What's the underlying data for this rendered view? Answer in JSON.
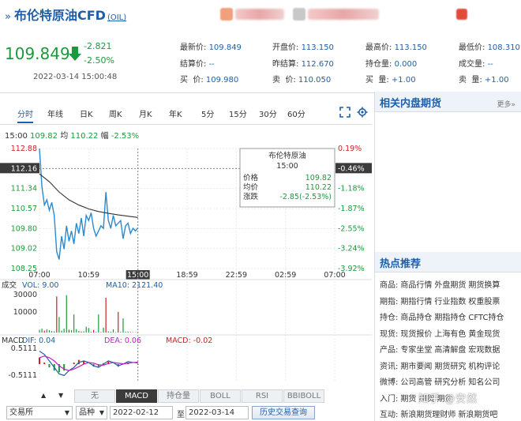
{
  "header": {
    "arrows": "»",
    "title": "布伦特原油CFD",
    "code": "(OIL)",
    "price": "109.849",
    "change_abs": "-2.821",
    "change_pct": "-2.50%",
    "datetime": "2022-03-14 15:00:48",
    "quotes": [
      {
        "label": "最新价: ",
        "value": "109.849",
        "color": "blue"
      },
      {
        "label": "开盘价: ",
        "value": "113.150",
        "color": "blue"
      },
      {
        "label": "最高价: ",
        "value": "113.150",
        "color": "blue"
      },
      {
        "label": "最低价: ",
        "value": "108.310",
        "color": "blue"
      },
      {
        "label": "结算价: ",
        "value": "--",
        "color": "blue"
      },
      {
        "label": "昨结算: ",
        "value": "112.670",
        "color": "blue"
      },
      {
        "label": "持仓量: ",
        "value": "0.000",
        "color": "blue"
      },
      {
        "label": "成交量: ",
        "value": "--",
        "color": "blue"
      },
      {
        "label": "买  价: ",
        "value": "109.980",
        "color": "blue"
      },
      {
        "label": "卖  价: ",
        "value": "110.050",
        "color": "blue"
      },
      {
        "label": "买  量: ",
        "value": "+1.00",
        "color": "blue"
      },
      {
        "label": "卖  量: ",
        "value": "+1.00",
        "color": "blue"
      }
    ]
  },
  "tabs": [
    "分时",
    "年线",
    "日K",
    "周K",
    "月K",
    "年K",
    "5分",
    "15分",
    "30分",
    "60分"
  ],
  "active_tab": "分时",
  "info_line": {
    "time": "15:00",
    "price": "109.82",
    "avg_label": "均",
    "avg": "110.22",
    "amp_label": "幅",
    "amp": "-2.53%"
  },
  "tooltip": {
    "name": "布伦特原油",
    "time": "15:00",
    "rows": [
      {
        "label": "价格",
        "value": "109.82"
      },
      {
        "label": "均价",
        "value": "110.22"
      },
      {
        "label": "涨跌",
        "value": "-2.85(-2.53%)"
      }
    ]
  },
  "volume_panel": {
    "label": "成交",
    "vol_label": "VOL: 9.00",
    "ma_label": "MA10: 2121.40",
    "ticks": [
      "30000",
      "10000"
    ]
  },
  "macd_panel": {
    "label": "MACD",
    "dif": "DIF: 0.04",
    "dea": "DEA: 0.06",
    "macd": "MACD: -0.02",
    "ticks": [
      "0.5111",
      "-0.5111"
    ]
  },
  "indicator_tabs": [
    "无",
    "MACD",
    "持仓量",
    "BOLL",
    "RSI",
    "BBIBOLL"
  ],
  "active_indicator": "MACD",
  "filters": {
    "exchange": "交易所",
    "variety": "品种",
    "date_from": "2022-02-12",
    "to_label": "至",
    "date_to": "2022-03-14",
    "history_button": "历史交易查询"
  },
  "sidebar": {
    "related_title": "相关内盘期货",
    "more": "更多»",
    "hot_title": "热点推荐",
    "hot_rows": [
      {
        "cat": "商品:",
        "links": [
          "商品行情",
          "外盘期货",
          "期货换算"
        ]
      },
      {
        "cat": "期指:",
        "links": [
          "期指行情",
          "行业指数",
          "权重股票"
        ]
      },
      {
        "cat": "持仓:",
        "links": [
          "商品持仓",
          "期指持仓",
          "CFTC持仓"
        ]
      },
      {
        "cat": "现货:",
        "links": [
          "现货报价",
          "上海有色",
          "黄金现货"
        ]
      },
      {
        "cat": "产品:",
        "links": [
          "专家坐堂",
          "高清解盘",
          "宏观数据"
        ]
      },
      {
        "cat": "资讯:",
        "links": [
          "期市要闻",
          "期货研究",
          "机构评论"
        ]
      },
      {
        "cat": "微博:",
        "links": [
          "公司高管",
          "研究分析",
          "知名公司"
        ]
      },
      {
        "cat": "入门:",
        "links": [
          "期货",
          "期货",
          "期货"
        ]
      },
      {
        "cat": "互动:",
        "links": [
          "新浪期货理财师",
          "新浪期货吧"
        ]
      }
    ]
  },
  "watermark": "知乎 @安然",
  "colors": {
    "accent": "#1f5fa8",
    "down": "#1a9a3a",
    "up": "#d02020",
    "price_line": "#2a8ad0",
    "avg_line": "#333333"
  },
  "chart_data": {
    "type": "line",
    "title": "",
    "x_ticks": [
      "07:00",
      "10:59",
      "15:00",
      "18:59",
      "22:59",
      "02:59",
      "07:00"
    ],
    "y_ticks_price": [
      112.88,
      112.16,
      111.34,
      110.57,
      109.8,
      109.02,
      108.25
    ],
    "y_ticks_pct": [
      "0.19%",
      "-0.46%",
      "-1.18%",
      "-1.87%",
      "-2.55%",
      "-3.24%",
      "-3.92%"
    ],
    "ylim": [
      108.25,
      112.88
    ],
    "series": [
      {
        "x": [
          0,
          0.05,
          0.1,
          0.15,
          0.2,
          0.25,
          0.3,
          0.35,
          0.4,
          0.45,
          0.5,
          0.55,
          0.6,
          0.65,
          0.7,
          0.75,
          0.8,
          0.85,
          0.9,
          0.95,
          1.0,
          1.05,
          1.1,
          1.15,
          1.2,
          1.25,
          1.3,
          1.35,
          1.4,
          1.45,
          1.5,
          1.55,
          1.6,
          1.65,
          1.7,
          1.75,
          1.8,
          1.85,
          1.9,
          1.95,
          2.0
        ],
        "values": [
          112.88,
          111.4,
          110.7,
          110.9,
          110.5,
          110.8,
          110.3,
          108.9,
          108.6,
          109.5,
          109.0,
          109.9,
          109.3,
          109.7,
          109.2,
          110.0,
          109.6,
          110.2,
          109.5,
          110.3,
          110.1,
          110.4,
          109.8,
          109.5,
          109.7,
          109.9,
          109.8,
          111.2,
          110.1,
          109.8,
          110.3,
          109.9,
          110.0,
          110.1,
          109.4,
          109.9,
          110.0,
          109.6,
          109.8,
          109.7,
          109.82
        ]
      },
      {
        "x": [
          0,
          0.2,
          0.4,
          0.6,
          0.8,
          1.0,
          1.2,
          1.4,
          1.6,
          1.8,
          2.0
        ],
        "values": [
          111.9,
          111.6,
          111.2,
          110.9,
          110.7,
          110.55,
          110.45,
          110.38,
          110.32,
          110.27,
          110.22
        ]
      }
    ],
    "volume": [
      2000,
      3000,
      1500,
      2500,
      1800,
      1200,
      900,
      28000,
      12000,
      1500,
      3000,
      29000,
      2200,
      1800,
      14000,
      2600,
      1200,
      800,
      900,
      4500,
      3500,
      600,
      2000,
      500,
      14000,
      400,
      3800,
      27000,
      900,
      600,
      2500,
      300,
      16000,
      500,
      11000,
      600,
      800,
      400,
      300,
      200,
      150
    ],
    "macd_dif": [
      0.4,
      0.3,
      0.1,
      -0.1,
      -0.3,
      -0.35,
      -0.2,
      -0.1,
      0.05,
      0.1,
      0.05,
      -0.05,
      -0.1,
      0.0,
      0.1,
      0.05,
      -0.05,
      0.0,
      0.08,
      0.05,
      0.04
    ],
    "macd_dea": [
      0.2,
      0.25,
      0.2,
      0.1,
      -0.05,
      -0.15,
      -0.2,
      -0.15,
      -0.08,
      0.0,
      0.05,
      0.03,
      -0.02,
      -0.03,
      0.02,
      0.05,
      0.03,
      0.01,
      0.03,
      0.05,
      0.06
    ],
    "macd_hist": [
      0.2,
      0.05,
      -0.1,
      -0.2,
      -0.25,
      -0.2,
      0.0,
      0.05,
      0.13,
      0.1,
      0.0,
      -0.08,
      -0.08,
      0.03,
      0.08,
      0.0,
      -0.08,
      -0.01,
      0.05,
      0.0,
      -0.02
    ]
  }
}
